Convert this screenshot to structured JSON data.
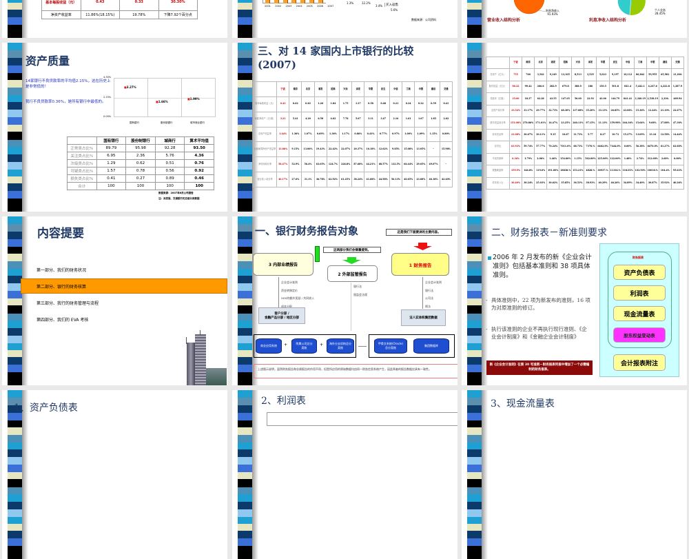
{
  "s1": {
    "table": [
      [
        "基本每股收益（元）",
        "0.43",
        "0.33",
        "30.30%"
      ],
      [
        "净资产收益率",
        "11.86%(18.15%)",
        "19.78%",
        "下降7.92个百分点"
      ]
    ]
  },
  "s2": {
    "years": [
      "2001",
      "2002",
      "2003",
      "2004",
      "2005",
      "2006",
      "2007"
    ],
    "pie_labels": {
      "a": "1.3%",
      "b": "12.2%",
      "c": "3.4%",
      "d": "买入返售",
      "e": "5.6%"
    },
    "source": "数据来源：公司资料",
    "accent": "#f5a030"
  },
  "s3": {
    "pie1": {
      "label": "利息净收入",
      "value": "91.93%",
      "title": "营业收入结构分析",
      "color": "#ff6600"
    },
    "pie2": {
      "label": "个人业务",
      "value": "28.45%",
      "title": "利息净收入结构分析"
    }
  },
  "s4": {
    "title": "资产质量",
    "text1": "14家银行不良贷款率的平均值2.15%，这在历史上是非常低的！",
    "text2": "我行不良贷款率0.36%，是所有银行中最低的。",
    "chart": {
      "ticks": [
        "4.30%",
        "2.15%",
        "0.00%"
      ],
      "categories": [
        "国有银行",
        "股份制银行",
        "城市商业银行"
      ],
      "values": [
        3.27,
        1.66,
        1.99
      ],
      "labels": [
        "3.27%",
        "1.66%",
        "1.99%"
      ],
      "ymax": 4.3
    },
    "table": [
      [
        "",
        "国有银行",
        "股份制银行",
        "城商行",
        "算术平均值"
      ],
      [
        "正常类占比%",
        "89.79",
        "95.98",
        "92.28",
        "93.50"
      ],
      [
        "关注类占比%",
        "6.95",
        "2.36",
        "5.76",
        "4.36"
      ],
      [
        "次级类占比%",
        "1.29",
        "0.62",
        "0.51",
        "0.76"
      ],
      [
        "可疑类占比%",
        "1.57",
        "0.78",
        "0.56",
        "0.92"
      ],
      [
        "损失类占比%",
        "0.41",
        "0.27",
        "0.89",
        "0.46"
      ],
      [
        "合计",
        "100",
        "100",
        "100",
        "100"
      ]
    ],
    "source1": "数据来源：2007年6月公司报告",
    "source2": "注：深发展、交通银行无五级分类数据"
  },
  "s5": {
    "title1": "三、对 14 家国内上市银行的比较",
    "title2": "(2007)",
    "table": [
      [
        "",
        "宁波",
        "南京",
        "北京",
        "浦发",
        "招商",
        "兴业",
        "深发",
        "华夏",
        "民生",
        "中信",
        "工商",
        "中银",
        "建设",
        "交通"
      ],
      [
        "基本每股收益（元）",
        "0.43",
        "0.62",
        "0.83",
        "1.26",
        "1.84",
        "1.75",
        "1.27",
        "0.58",
        "0.48",
        "0.21",
        "0.24",
        "0.22",
        "0.59",
        "0.41"
      ],
      [
        "每股净资产（元/股）",
        "3.21",
        "5.41",
        "4.20",
        "6.58",
        "4.62",
        "7.78",
        "5.67",
        "3.11",
        "3.47",
        "2.16",
        "1.61",
        "1.67",
        "1.85",
        "2.62"
      ],
      [
        "总资产收益率",
        "1.44%",
        "1.36%",
        "1.07%",
        "0.69%",
        "1.36%",
        "1.17%",
        "0.86%",
        "0.41%",
        "0.77%",
        "0.97%",
        "1.00%",
        "1.09%",
        "1.15%",
        "0.80%"
      ],
      [
        "全面摊薄净资产收益率",
        "13.86%",
        "9.15%",
        "13.06%",
        "19.43%",
        "22.42%",
        "22.07%",
        "20.37%",
        "16.18%",
        "12.62%",
        "9.85%",
        "15.08%",
        "13.05%",
        "-",
        "15.98%"
      ],
      [
        "净利润增长率",
        "58.47%",
        "52.9%",
        "56.4%",
        "63.05%",
        "124.7%",
        "226.8%",
        "87.68%",
        "44.21%",
        "68.57%",
        "132.5%",
        "66.44%",
        "29.05%",
        "49.07%",
        "-"
      ],
      [
        "营业收入增长率",
        "40.17%",
        "27.6%",
        "31.1%",
        "36.78%",
        "62.92%",
        "61.45%",
        "38.24%",
        "41.68%",
        "44.98%",
        "56.13%",
        "40.65%",
        "23.68%",
        "46.18%",
        "43.40%"
      ]
    ]
  },
  "s6": {
    "table": [
      [
        "",
        "宁波",
        "南京",
        "北京",
        "浦发",
        "招商",
        "兴业",
        "深发",
        "华夏",
        "民生",
        "中信",
        "工商",
        "中银",
        "建设",
        "交通"
      ],
      [
        "总资产（亿元）",
        "755",
        "760",
        "3,542",
        "9,149",
        "13,105",
        "8,513",
        "3,525",
        "5,023",
        "9,197",
        "10,112",
        "86,842",
        "59,955",
        "65,981",
        "21,036"
      ],
      [
        "股东权益（亿元）",
        "80.22",
        "99.42",
        "266.6",
        "282.9",
        "679.8",
        "388.9",
        "186",
        "150.5",
        "501.8",
        "841.4",
        "5,442.1",
        "4,247.6",
        "4,222.8",
        "1,287.9"
      ],
      [
        "总股本（亿股）",
        "25.00",
        "18.37",
        "62.28",
        "43.55",
        "147.05",
        "50.00",
        "22.93",
        "43.00",
        "144.79",
        "841.41",
        "3,340.19",
        "2,538.19",
        "2,336.",
        "489.94"
      ],
      [
        "总资产增长率",
        "33.54%",
        "31.17%",
        "29.77%",
        "32.73%",
        "48.30%",
        "137.08%",
        "35.20%",
        "33.13%",
        "26.85%",
        "43.06%",
        "15.36%",
        "12.44%",
        "21.10%",
        "22.67%"
      ],
      [
        "股东权益增长率",
        "151.08%",
        "278.86%",
        "171.01%",
        "14.47%",
        "23.25%",
        "240.11%",
        "97.15%",
        "11.13%",
        "159.98%",
        "164.34%",
        "15.64%",
        "9.68%",
        "27.88%",
        "47.30%"
      ],
      [
        "资本充足率",
        "21.08%",
        "30.67%",
        "30.11%",
        "9.15",
        "10.67",
        "11.73%",
        "5.77",
        "8.27",
        "10.73",
        "15.27%",
        "13.09%",
        "13.34",
        "12.58%",
        "14.44%"
      ],
      [
        "存贷比",
        "63.93%",
        "59.74%",
        "57.77%",
        "70.24%",
        "7011.0%",
        "68.73%",
        "7370.%",
        "6462.0%",
        "7444.0%",
        "0.00%",
        "56.38%",
        "6470.0%",
        "61.27%",
        "62.60%"
      ],
      [
        "不良贷款率",
        "0.36%",
        "1.79%",
        "2.06%",
        "1.46%",
        "154.00%",
        "1.15%",
        "562.00%",
        "225.00%",
        "122.00%",
        "1.48%",
        "2.74%",
        "312.00%",
        "2.60%",
        "0.00%"
      ],
      [
        "拨备覆盖率",
        "359.9%",
        "146.8%",
        "119.0%",
        "191.00%",
        "18838.%",
        "153.21%",
        "4828.%",
        "30937.%",
        "11334.%",
        "118.01%",
        "103.50%",
        "10018.%",
        "104.4%",
        "95.63%"
      ],
      [
        "成本收入比",
        "36.40%",
        "30.24%",
        "25.03%",
        "30.62%",
        "35.85%",
        "36.53%",
        "38.93%",
        "40.29%",
        "46.26%",
        "34.89%",
        "34.40%",
        "30.87%",
        "35.92%",
        "40.26%"
      ]
    ]
  },
  "s7": {
    "title": "内容提要",
    "items": [
      "第一部分、我们的财务状况",
      "第二部分、银行的财务核算",
      "第三部分、我行的财务管理与流程",
      "第四部分、我们的 EVA 考核"
    ],
    "highlight": "#ff9900"
  },
  "s8": {
    "title": "一、银行财务报告对象",
    "note1": "这是我们下面要讲的主要内容。",
    "note2": "这两部分我们会侧重提到。",
    "box3": "3 内部业绩报告",
    "box2": "2 外部监管报告",
    "box1": "1 财务报告",
    "list3": [
      "企业会计准则",
      "资金转移定价",
      "MIS的额外奖励 / 共同收入",
      "成本分配"
    ],
    "list2": [
      "银行法",
      "银监会法规"
    ],
    "list1": [
      "企业会计准则",
      "银行法",
      "公司法",
      "税法"
    ],
    "seg1": "客户分部 /",
    "seg2": "金融产品分部 / 地区分部",
    "entity": "法人实体和集团数据",
    "cyl": [
      "商业应用系统",
      "附属公司总分类账",
      "海外分支机构总分类账",
      "甲骨文系统(Oracle)总分类账",
      "集团数据库"
    ],
    "plus": "+",
    "footer": "上述图示说明，虽然财务报告和业绩报告的作用不同，但是所应用的原始数据均由同一财务信息系统产生，因此两者的报告数据应具有一致性。"
  },
  "s9": {
    "title": "二、财务报表－新准则要求",
    "bullet": "2006 年 2 月发布的新《企业会计准则》包括基本准则和 38 项具体准则。",
    "sub1": "具体准则中，22 项为新发布的准则，16 项为对原准则的修订。",
    "sub2": "执行该准则的企业不再执行现行准则、《企业会计制度》和《金融企业会计制度》",
    "note": "新《企业会计准则》在第 30 号准则－财务报表列报中增加了一个必需编制的财务报表。",
    "box_label": "财务报表",
    "items": [
      "资产负债表",
      "利润表",
      "现金流量表",
      "股东权益变动表",
      "会计报表附注"
    ]
  },
  "s10": {
    "title": "1、资产负债表"
  },
  "s11": {
    "title": "2、利润表"
  },
  "s12": {
    "title": "3、现金流量表"
  }
}
